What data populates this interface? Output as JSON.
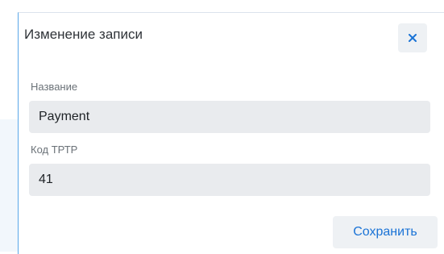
{
  "dialog": {
    "title": "Изменение записи",
    "close_icon": "close-icon",
    "save_label": "Сохранить"
  },
  "fields": [
    {
      "label": "Название",
      "value": "Payment"
    },
    {
      "label": "Код ТРТР",
      "value": "41"
    }
  ],
  "colors": {
    "accent": "#1a73d6",
    "dialog_border": "#5aa7e8",
    "input_bg": "#e9ebee",
    "button_bg": "#eef1f4"
  }
}
